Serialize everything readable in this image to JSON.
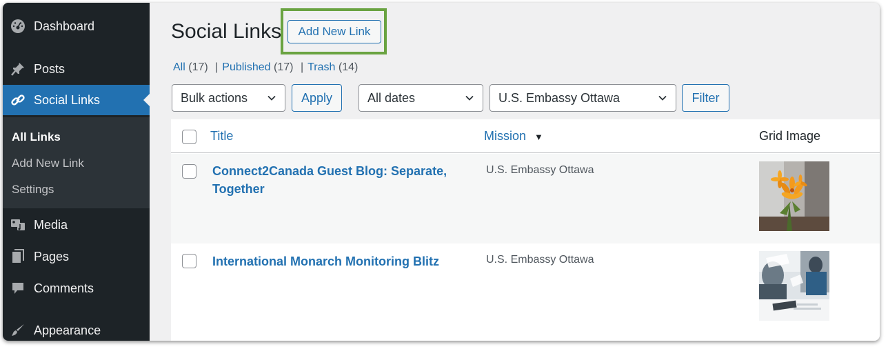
{
  "sidebar": {
    "items": [
      {
        "label": "Dashboard",
        "icon": "dashboard-icon"
      },
      {
        "label": "Posts",
        "icon": "pin-icon"
      },
      {
        "label": "Social Links",
        "icon": "link-icon"
      },
      {
        "label": "Media",
        "icon": "media-icon"
      },
      {
        "label": "Pages",
        "icon": "pages-icon"
      },
      {
        "label": "Comments",
        "icon": "comment-icon"
      },
      {
        "label": "Appearance",
        "icon": "brush-icon"
      }
    ],
    "submenu": [
      "All Links",
      "Add New Link",
      "Settings"
    ]
  },
  "page": {
    "title": "Social Links",
    "add_new_label": "Add New Link"
  },
  "filters": {
    "all_label": "All",
    "all_count": "(17)",
    "published_label": "Published",
    "published_count": "(17)",
    "trash_label": "Trash",
    "trash_count": "(14)",
    "separator": "|"
  },
  "toolbar": {
    "bulk_actions": "Bulk actions",
    "apply": "Apply",
    "dates": "All dates",
    "mission": "U.S. Embassy Ottawa",
    "filter": "Filter"
  },
  "table": {
    "columns": {
      "title": "Title",
      "mission": "Mission",
      "mission_sort": "▼",
      "grid_image": "Grid Image"
    },
    "rows": [
      {
        "title": "Connect2Canada Guest Blog: Separate, Together",
        "mission": "U.S. Embassy Ottawa",
        "image": "orange-lily-photo"
      },
      {
        "title": "International Monarch Monitoring Blitz",
        "mission": "U.S. Embassy Ottawa",
        "image": "office-meeting-photo"
      }
    ]
  },
  "colors": {
    "sidebar_bg": "#1d2327",
    "accent": "#2271b1",
    "highlight": "#6aa341"
  }
}
